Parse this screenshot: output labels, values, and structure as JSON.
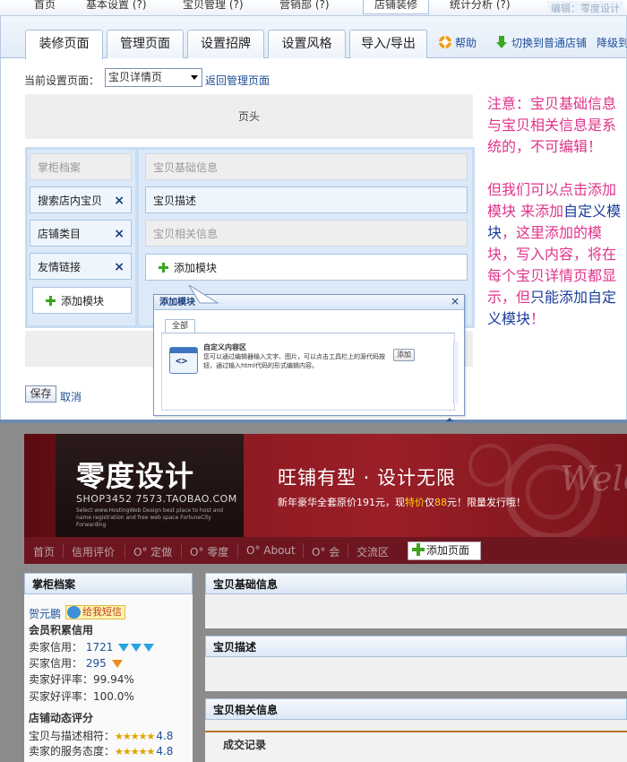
{
  "top_nav": {
    "items": [
      {
        "label": "首页"
      },
      {
        "label": "基本设置 (?)"
      },
      {
        "label": "宝贝管理 (?)"
      },
      {
        "label": "营销部 (?)"
      },
      {
        "label": "店铺装修"
      },
      {
        "label": "统计分析 (?)"
      }
    ],
    "editor_caption": "编辑：零度设计"
  },
  "tabs": [
    {
      "label": "装修页面"
    },
    {
      "label": "管理页面"
    },
    {
      "label": "设置招牌"
    },
    {
      "label": "设置风格"
    },
    {
      "label": "导入/导出"
    }
  ],
  "tools": {
    "help": "帮助",
    "switch": "切换到普通店铺",
    "downgrade": "降级到"
  },
  "current_page": {
    "label": "当前设置页面：",
    "selected": "宝贝详情页",
    "back_link": "返回管理页面"
  },
  "header_block": "页头",
  "left_modules": [
    {
      "label": "掌柜档案"
    },
    {
      "label": "搜索店内宝贝"
    },
    {
      "label": "店铺类目"
    },
    {
      "label": "友情链接"
    }
  ],
  "right_modules": [
    {
      "label": "宝贝基础信息"
    },
    {
      "label": "宝贝描述"
    },
    {
      "label": "宝贝相关信息"
    }
  ],
  "add_module_label": "添加模块",
  "close_glyph": "×",
  "popup": {
    "title": "添加模块",
    "close": "×",
    "tab": "全部",
    "icon_text": "<>",
    "module_name": "自定义内容区",
    "module_desc": "您可以通过编辑器输入文字、图片，可以点击工具栏上的源代码按钮，通过输入html代码的形式编辑内容。",
    "add_button": "添加"
  },
  "save_button": "保存",
  "cancel_link": "取消",
  "annotation": {
    "p1": "注意：宝贝基础信息与宝贝相关信息是系统的，不可编辑！",
    "p2_a": "但我们可以点击添加模块 来添加",
    "p2_b": "自定义模块",
    "p2_c": "，这里添加的模块，写入内容，将在每个宝贝详情页都显示，但",
    "p2_d": "只能添加自定义模块",
    "p2_e": "！"
  },
  "banner": {
    "title": "零度设计",
    "url": "SHOP3452 7573.TAOBAO.COM",
    "small_text": "Select www.HostingWeb Design best place to host and name registration and free web space FortuneCity Forwarding",
    "slogan": "旺铺有型 · 设计无限",
    "promo_a": "新年豪华全套原价191元，现",
    "promo_b": "特价",
    "promo_c": "仅",
    "promo_d": "88",
    "promo_e": "元！限量发行哦！",
    "welcome": "Welc"
  },
  "shop_nav": [
    {
      "label": "首页"
    },
    {
      "label": "信用评价"
    },
    {
      "label": "O° 定做"
    },
    {
      "label": "O° 零度"
    },
    {
      "label": "O° About"
    },
    {
      "label": "O° 会"
    },
    {
      "label": "交流区"
    }
  ],
  "add_page_button": "添加页面",
  "shop_left": {
    "title": "掌柜档案",
    "seller_name": "贺元鹏",
    "msg_badge": "给我短信",
    "credit_heading": "会员积累信用",
    "seller_credit_label": "卖家信用：",
    "seller_credit_value": "1721",
    "buyer_credit_label": "买家信用：",
    "buyer_credit_value": "295",
    "seller_good_rate": "卖家好评率：99.94%",
    "buyer_good_rate": "买家好评率：100.0%",
    "dsr_heading": "店铺动态评分",
    "dsr_desc_label": "宝贝与描述相符：",
    "dsr_desc_value": "4.8",
    "dsr_service_label": "卖家的服务态度：",
    "dsr_service_value": "4.8",
    "stars_glyph": "★★★★★"
  },
  "shop_right": {
    "panels": [
      {
        "title": "宝贝基础信息"
      },
      {
        "title": "宝贝描述"
      },
      {
        "title": "宝贝相关信息"
      }
    ],
    "deal_record": "成交记录"
  },
  "colors": {
    "annotation_pink": "#e0338a",
    "annotation_blue": "#1a3c9a",
    "banner_red": "#8e1a22",
    "shopnav_bg": "#6d1620"
  }
}
